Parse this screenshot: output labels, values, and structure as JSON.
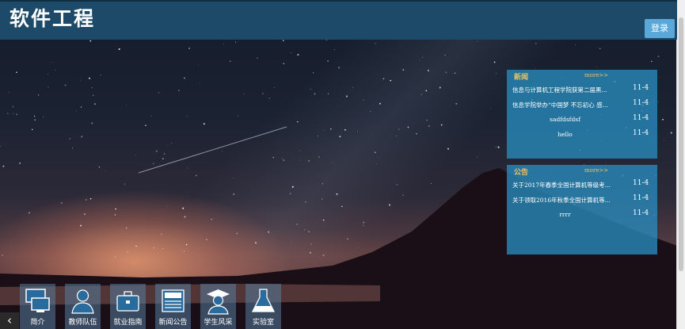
{
  "header": {
    "title": "软件工程",
    "login_label": "登录"
  },
  "news": {
    "title": "新闻",
    "more": "more>>",
    "items": [
      {
        "text": "信息与计算机工程学院获第二届黑...",
        "date": "11-4"
      },
      {
        "text": "信息学院举办“中国梦 不忘初心 感...",
        "date": "11-4"
      },
      {
        "text": "sadfdsfdsf",
        "date": "11-4"
      },
      {
        "text": "hello",
        "date": "11-4"
      }
    ]
  },
  "notice": {
    "title": "公告",
    "more": "more>>",
    "items": [
      {
        "text": "关于2017年春季全国计算机等级考...",
        "date": "11-4"
      },
      {
        "text": "关于领取2016年秋季全国计算机等...",
        "date": "11-4"
      },
      {
        "text": "rrrr",
        "date": "11-4"
      }
    ]
  },
  "bottom_nav": [
    {
      "label": "简介",
      "icon": "computer-icon"
    },
    {
      "label": "教师队伍",
      "icon": "teacher-icon"
    },
    {
      "label": "就业指南",
      "icon": "briefcase-icon"
    },
    {
      "label": "新闻公告",
      "icon": "newspaper-icon"
    },
    {
      "label": "学生风采",
      "icon": "graduate-icon"
    },
    {
      "label": "实验室",
      "icon": "flask-icon"
    }
  ],
  "prev_label": "‹",
  "colors": {
    "header": "#1c4a68",
    "panel": "#288cbe",
    "accent": "#f0c060",
    "login": "#5aa8da"
  }
}
